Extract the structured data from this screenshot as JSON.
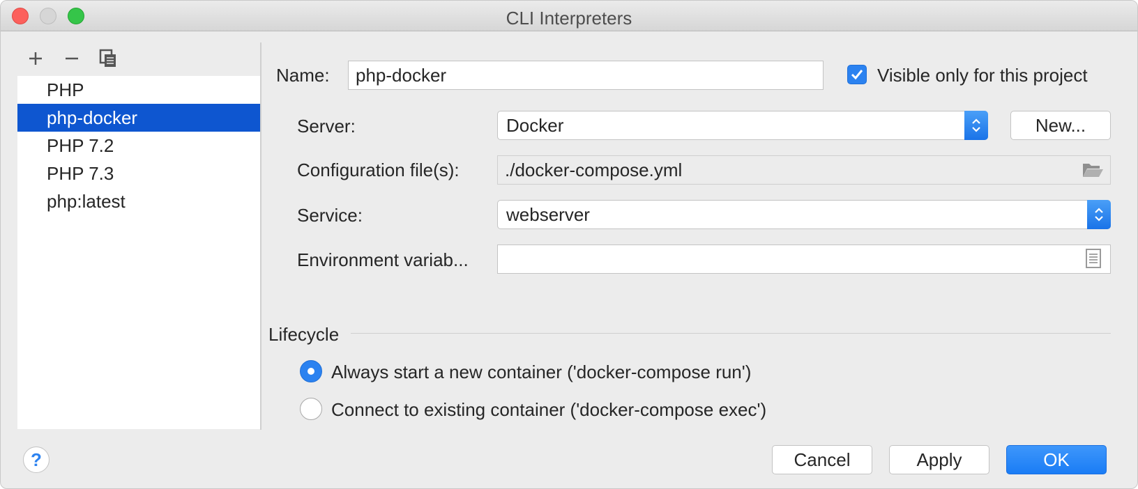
{
  "window": {
    "title": "CLI Interpreters"
  },
  "toolbar": {
    "add_icon": "plus-icon",
    "remove_icon": "minus-icon",
    "copy_icon": "copy-icon"
  },
  "interpreters": {
    "items": [
      {
        "label": "PHP",
        "selected": false
      },
      {
        "label": "php-docker",
        "selected": true
      },
      {
        "label": "PHP 7.2",
        "selected": false
      },
      {
        "label": "PHP 7.3",
        "selected": false
      },
      {
        "label": "php:latest",
        "selected": false
      }
    ]
  },
  "form": {
    "name_label": "Name:",
    "name_value": "php-docker",
    "visible_label": "Visible only for this project",
    "visible_checked": true,
    "server_label": "Server:",
    "server_value": "Docker",
    "new_button": "New...",
    "config_label": "Configuration file(s):",
    "config_value": "./docker-compose.yml",
    "service_label": "Service:",
    "service_value": "webserver",
    "env_label": "Environment variab...",
    "env_value": ""
  },
  "lifecycle": {
    "title": "Lifecycle",
    "options": [
      {
        "label": "Always start a new container ('docker-compose run')",
        "checked": true
      },
      {
        "label": "Connect to existing container ('docker-compose exec')",
        "checked": false
      }
    ]
  },
  "buttons": {
    "help": "?",
    "cancel": "Cancel",
    "apply": "Apply",
    "ok": "OK"
  },
  "colors": {
    "selection": "#0e56d0",
    "accent": "#2b82f0"
  }
}
